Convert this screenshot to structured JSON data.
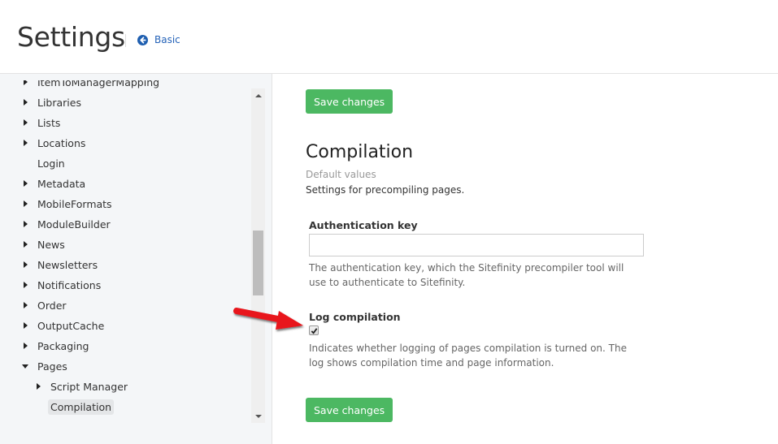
{
  "header": {
    "title": "Settings",
    "back_link": {
      "label": "Basic",
      "icon": "arrow-circle-left-icon",
      "color": "#1f5fb0"
    }
  },
  "sidebar": {
    "items": [
      {
        "label": "ItemToManagerMapping",
        "level": 0,
        "caret": "right",
        "selected": false
      },
      {
        "label": "Libraries",
        "level": 0,
        "caret": "right",
        "selected": false
      },
      {
        "label": "Lists",
        "level": 0,
        "caret": "right",
        "selected": false
      },
      {
        "label": "Locations",
        "level": 0,
        "caret": "right",
        "selected": false
      },
      {
        "label": "Login",
        "level": 0,
        "caret": "none",
        "selected": false
      },
      {
        "label": "Metadata",
        "level": 0,
        "caret": "right",
        "selected": false
      },
      {
        "label": "MobileFormats",
        "level": 0,
        "caret": "right",
        "selected": false
      },
      {
        "label": "ModuleBuilder",
        "level": 0,
        "caret": "right",
        "selected": false
      },
      {
        "label": "News",
        "level": 0,
        "caret": "right",
        "selected": false
      },
      {
        "label": "Newsletters",
        "level": 0,
        "caret": "right",
        "selected": false
      },
      {
        "label": "Notifications",
        "level": 0,
        "caret": "right",
        "selected": false
      },
      {
        "label": "Order",
        "level": 0,
        "caret": "right",
        "selected": false
      },
      {
        "label": "OutputCache",
        "level": 0,
        "caret": "right",
        "selected": false
      },
      {
        "label": "Packaging",
        "level": 0,
        "caret": "right",
        "selected": false
      },
      {
        "label": "Pages",
        "level": 0,
        "caret": "down",
        "selected": false
      },
      {
        "label": "Script Manager",
        "level": 1,
        "caret": "right",
        "selected": false
      },
      {
        "label": "Compilation",
        "level": 1,
        "caret": "none",
        "selected": true
      }
    ]
  },
  "main": {
    "save_label": "Save changes",
    "save_color": "#4cb862",
    "section_title": "Compilation",
    "default_values": "Default values",
    "section_desc": "Settings for precompiling pages.",
    "fields": {
      "auth_key": {
        "label": "Authentication key",
        "value": "",
        "placeholder": "",
        "help": "The authentication key, which the Sitefinity precompiler tool will use to authenticate to Sitefinity."
      },
      "log_compilation": {
        "label": "Log compilation",
        "checked": true,
        "help": "Indicates whether logging of pages compilation is turned on. The log shows compilation time and page information."
      }
    }
  },
  "annotation": {
    "type": "arrow",
    "color": "#e8141a",
    "points_to": "log-compilation-checkbox"
  }
}
